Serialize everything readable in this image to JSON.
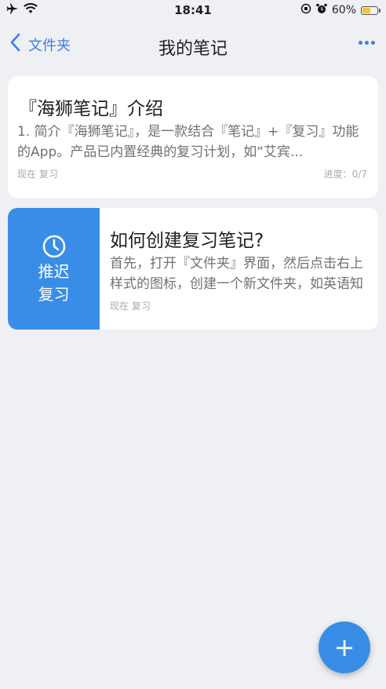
{
  "status_bar": {
    "time": "18:41",
    "battery_percent": "60%",
    "battery_level": 0.6
  },
  "nav": {
    "back_label": "文件夹",
    "title": "我的笔记"
  },
  "notes": [
    {
      "title": "『海狮笔记』介绍",
      "excerpt": "1. 简介『海狮笔记』，是一款结合『笔记』+『复习』功能的App。产品已内置经典的复习计划，如“艾宾...",
      "meta": "现在 复习",
      "progress": "进度：0/7"
    },
    {
      "title": "如何创建复习笔记?",
      "excerpt_line1": "首先，打开『文件夹』界面，然后点击右上",
      "excerpt_line2": "样式的图标，创建一个新文件夹，如英语知",
      "meta": "现在 复习",
      "swipe_action_line1": "推迟",
      "swipe_action_line2": "复习"
    }
  ],
  "fab": {
    "icon": "plus-icon",
    "label": "+"
  },
  "colors": {
    "accent": "#3a8de7",
    "background": "#eff0f4"
  }
}
